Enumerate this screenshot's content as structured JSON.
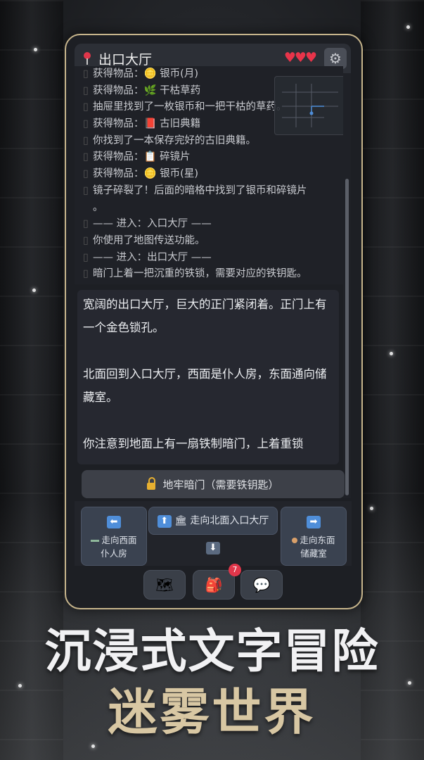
{
  "header": {
    "title": "出口大厅",
    "hearts": "♥♥♥",
    "settings_icon": "gear-icon"
  },
  "log": [
    {
      "text": "获得物品：🪙 银币(月)"
    },
    {
      "text": "获得物品：🌿 干枯草药"
    },
    {
      "text": "抽屉里找到了一枚银币和一把干枯的草药。"
    },
    {
      "text": "获得物品：📕 古旧典籍"
    },
    {
      "text": "你找到了一本保存完好的古旧典籍。"
    },
    {
      "text": "获得物品：📋 碎镜片"
    },
    {
      "text": "获得物品：🪙 银币(星)"
    },
    {
      "text": "镜子碎裂了！后面的暗格中找到了银币和碎镜片"
    },
    {
      "text": "。",
      "nobullet": true
    },
    {
      "text": "—— 进入：入口大厅 ——"
    },
    {
      "text": "你使用了地图传送功能。"
    },
    {
      "text": "—— 进入：出口大厅 ——"
    },
    {
      "text": "暗门上着一把沉重的铁锁，需要对应的铁钥匙。"
    }
  ],
  "description": [
    "宽阔的出口大厅，巨大的正门紧闭着。正门上有一个金色锁孔。",
    "北面回到入口大厅，西面是仆人房，东面通向储藏室。",
    "你注意到地面上有一扇铁制暗门，上着重锁"
  ],
  "actions": {
    "locked_door": "地牢暗门（需要铁钥匙）"
  },
  "nav": {
    "west": {
      "arrow": "⬅",
      "line1": "走向西面",
      "line2": "仆人房"
    },
    "north": {
      "arrow": "⬆",
      "icon": "🏛",
      "label": "走向北面入口大厅"
    },
    "east": {
      "arrow": "➡",
      "line1": "走向东面",
      "line2": "储藏室"
    },
    "south": {
      "arrow": "⬇"
    }
  },
  "toolbar": {
    "map_icon": "🗺",
    "bag_icon": "🎒",
    "bag_badge": "7",
    "chat_icon": "💬"
  },
  "slogan": {
    "line1": "沉浸式文字冒险",
    "line2": "迷雾世界"
  },
  "colors": {
    "frame": "#c7b58c",
    "heart": "#e8344a",
    "arrow": "#4f8ed9",
    "slogan_gold": "#d8c7a3"
  }
}
